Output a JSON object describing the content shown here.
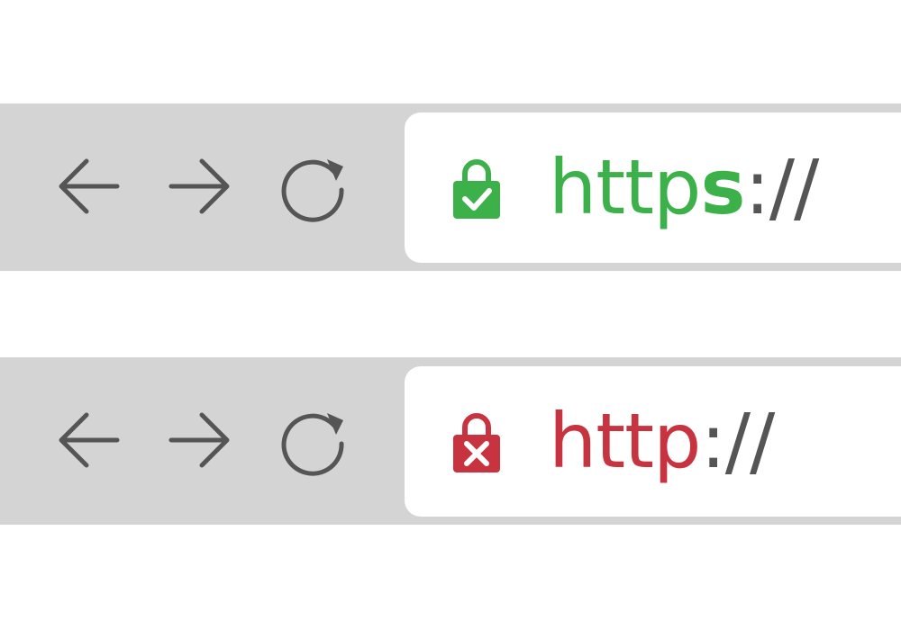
{
  "colors": {
    "toolbar_bg": "#d4d4d4",
    "address_bg": "#ffffff",
    "icon_gray": "#555555",
    "secure_green": "#3cb14a",
    "insecure_red": "#c83340"
  },
  "bars": [
    {
      "state": "secure",
      "lock_icon": "lock-check-icon",
      "url_scheme": "http",
      "url_secure_suffix": "s",
      "url_separator": "://",
      "nav": {
        "back_icon": "arrow-left-icon",
        "forward_icon": "arrow-right-icon",
        "reload_icon": "reload-icon"
      }
    },
    {
      "state": "insecure",
      "lock_icon": "lock-x-icon",
      "url_scheme": "http",
      "url_secure_suffix": "",
      "url_separator": "://",
      "nav": {
        "back_icon": "arrow-left-icon",
        "forward_icon": "arrow-right-icon",
        "reload_icon": "reload-icon"
      }
    }
  ]
}
